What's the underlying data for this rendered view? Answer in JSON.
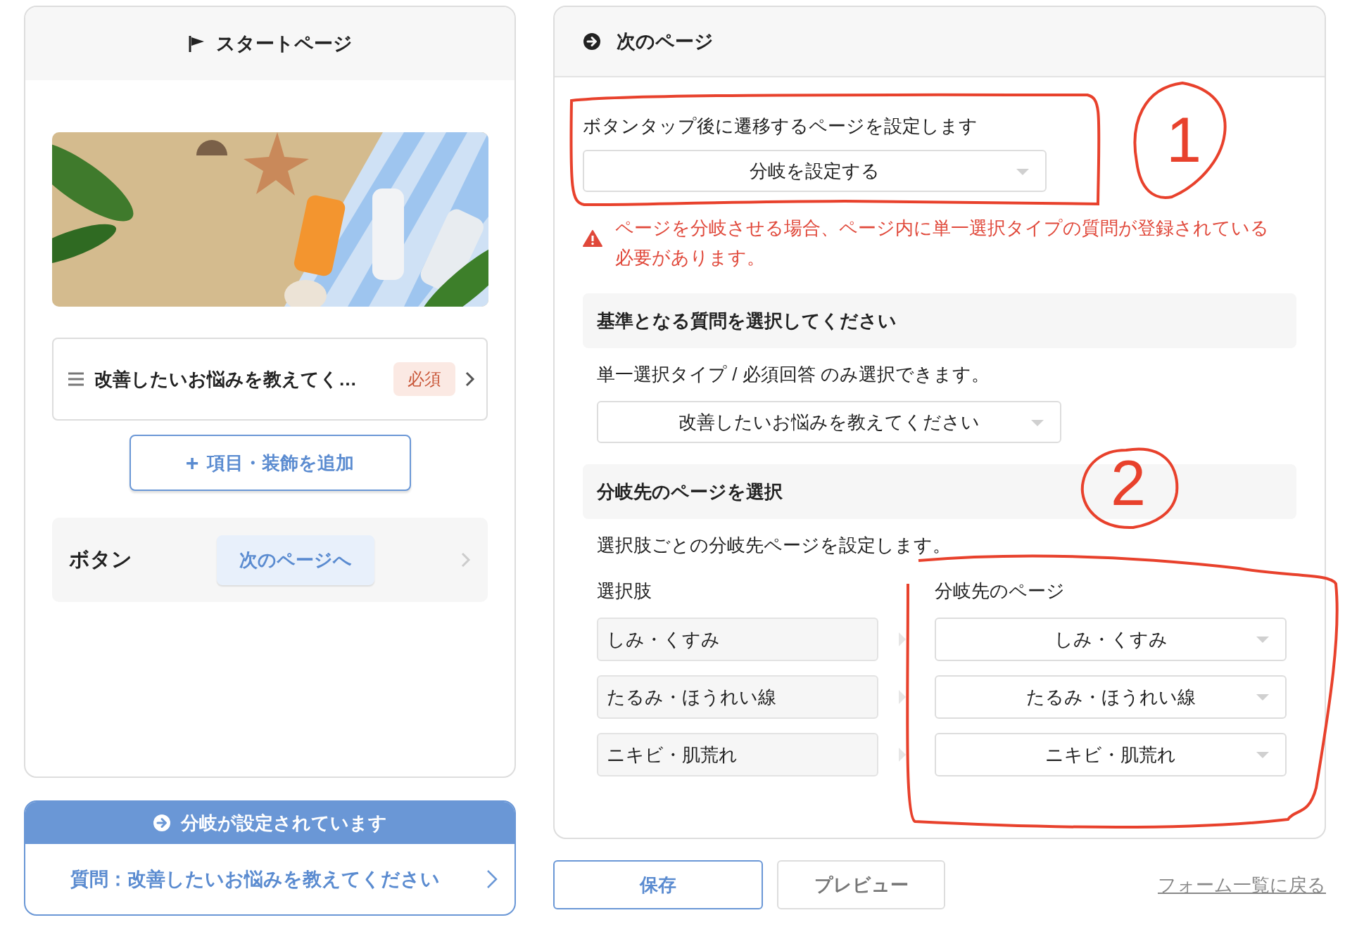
{
  "start_page": {
    "title": "スタートページ",
    "items": [
      {
        "kind": "question",
        "label": "改善したいお悩みを教えてく…",
        "badge": "必須"
      }
    ],
    "add_button": {
      "icon": "+",
      "label": "項目・装飾を追加"
    },
    "button_row": {
      "label": "ボタン",
      "button": "次のページへ"
    }
  },
  "branch_notice": {
    "title": "分岐が設定されています",
    "question": "質問：改善したいお悩みを教えてください"
  },
  "next_page": {
    "title": "次のページ",
    "description": "ボタンタップ後に遷移するページを設定します",
    "transition_select": "分岐を設定する",
    "warning": "ページを分岐させる場合、ページ内に単一選択タイプの質問が登録されている必要があります。",
    "base_question": {
      "heading": "基準となる質問を選択してください",
      "note": "単一選択タイプ / 必須回答 のみ選択できます。",
      "select": "改善したいお悩みを教えてください"
    },
    "branch_targets": {
      "heading": "分岐先のページを選択",
      "note": "選択肢ごとの分岐先ページを設定します。",
      "columns": [
        "選択肢",
        "分岐先のページ"
      ],
      "rows": [
        {
          "choice": "しみ・くすみ",
          "target": "しみ・くすみ"
        },
        {
          "choice": "たるみ・ほうれい線",
          "target": "たるみ・ほうれい線"
        },
        {
          "choice": "ニキビ・肌荒れ",
          "target": "ニキビ・肌荒れ"
        }
      ]
    }
  },
  "footer": {
    "save": "保存",
    "preview": "プレビュー",
    "back_link": "フォーム一覧に戻る"
  },
  "annotations": [
    {
      "kind": "outline"
    },
    {
      "kind": "number",
      "label": "1"
    },
    {
      "kind": "number",
      "label": "2"
    },
    {
      "kind": "outline"
    }
  ]
}
